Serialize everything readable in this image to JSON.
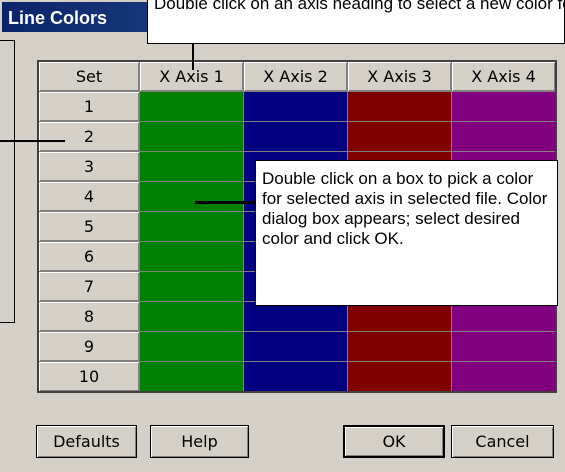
{
  "window": {
    "title": "Line Colors"
  },
  "grid": {
    "set_header": "Set",
    "axis_headers": [
      "X Axis 1",
      "X Axis 2",
      "X Axis 3",
      "X Axis 4"
    ],
    "axis_colors": [
      "#008000",
      "#000080",
      "#800000",
      "#800080"
    ],
    "rows": [
      "1",
      "2",
      "3",
      "4",
      "5",
      "6",
      "7",
      "8",
      "9",
      "10"
    ]
  },
  "buttons": {
    "defaults": "Defaults",
    "help": "Help",
    "ok": "OK",
    "cancel": "Cancel"
  },
  "callouts": {
    "top": "Double click on an axis heading to select a new color for that axis, for all files. Color wheel dialog box appears.",
    "middle": "Double click on a box to pick a color for selected axis in selected file. Color dialog box appears; select desired color and click OK."
  }
}
